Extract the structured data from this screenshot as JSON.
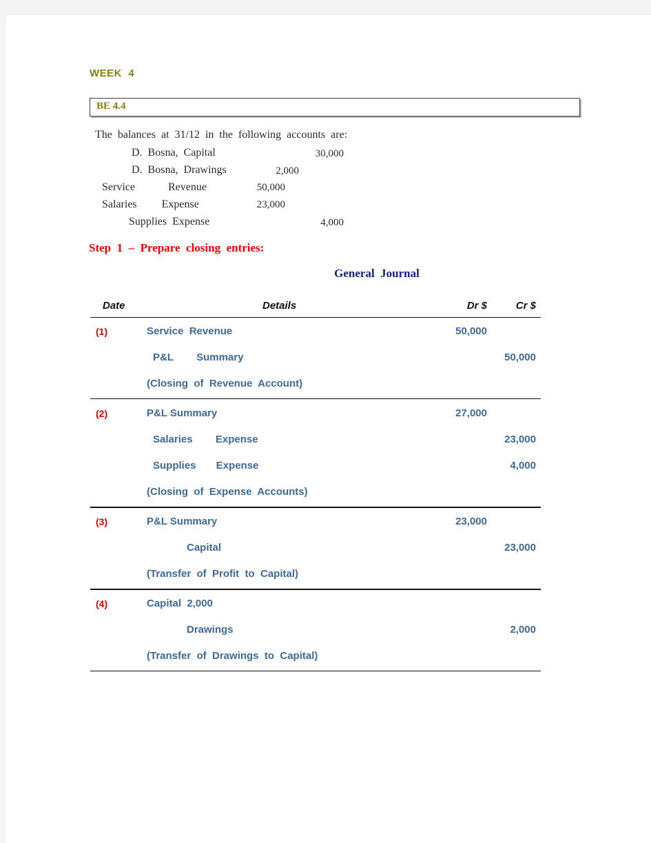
{
  "page": {
    "week_heading": "WEEK  4",
    "exercise_label": "BE 4.4"
  },
  "balances": {
    "intro": "The  balances  at  31/12  in  the  following  accounts  are:",
    "rows": [
      {
        "account": "D.  Bosna,  Capital",
        "amount": "30,000"
      },
      {
        "account": "D.  Bosna,  Drawings",
        "amount": "2,000"
      },
      {
        "account": "Service            Revenue",
        "amount": "50,000"
      },
      {
        "account": "Salaries         Expense",
        "amount": "23,000"
      },
      {
        "account": "Supplies  Expense",
        "amount": "4,000"
      }
    ]
  },
  "step": {
    "heading": "Step  1  –  Prepare  closing  entries:"
  },
  "journal": {
    "title": "General  Journal",
    "columns": {
      "date": "Date",
      "details": "Details",
      "debit": "Dr $",
      "credit": "Cr $"
    },
    "entries": [
      {
        "number": "(1)",
        "lines": [
          {
            "details": "Service  Revenue",
            "indent": 0,
            "dr": "50,000",
            "cr": ""
          },
          {
            "details": "P&L        Summary",
            "indent": 1,
            "dr": "",
            "cr": "50,000"
          },
          {
            "details": "(Closing  of  Revenue  Account)",
            "indent": 0,
            "dr": "",
            "cr": ""
          }
        ]
      },
      {
        "number": "(2)",
        "lines": [
          {
            "details": "P&L Summary",
            "indent": 0,
            "dr": "27,000",
            "cr": ""
          },
          {
            "details": "Salaries        Expense",
            "indent": 1,
            "dr": "",
            "cr": "23,000"
          },
          {
            "details": "Supplies       Expense",
            "indent": 1,
            "dr": "",
            "cr": "4,000"
          },
          {
            "details": "(Closing  of  Expense  Accounts)",
            "indent": 0,
            "dr": "",
            "cr": ""
          }
        ]
      },
      {
        "number": "(3)",
        "lines": [
          {
            "details": "P&L Summary",
            "indent": 0,
            "dr": "23,000",
            "cr": ""
          },
          {
            "details": "Capital",
            "indent": 2,
            "dr": "",
            "cr": "23,000"
          },
          {
            "details": "(Transfer  of  Profit  to  Capital)",
            "indent": 0,
            "dr": "",
            "cr": ""
          }
        ]
      },
      {
        "number": "(4)",
        "lines": [
          {
            "details": "Capital  2,000",
            "indent": 0,
            "dr": "",
            "cr": ""
          },
          {
            "details": "Drawings",
            "indent": 2,
            "dr": "",
            "cr": "2,000"
          },
          {
            "details": "(Transfer  of  Drawings  to  Capital)",
            "indent": 0,
            "dr": "",
            "cr": ""
          }
        ]
      }
    ]
  },
  "colors": {
    "heading": "#87800f",
    "step": "#fa0000",
    "journal_title": "#131d8c",
    "entry_text": "#3d6a9a",
    "entry_number": "#e50000",
    "page_background": "#f4f4f4"
  }
}
